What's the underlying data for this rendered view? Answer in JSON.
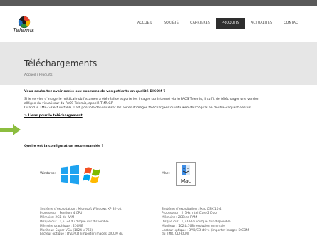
{
  "header": {
    "logo_text": "Telemis",
    "nav": [
      {
        "label": "ACCUEIL",
        "active": false
      },
      {
        "label": "SOCIÉTÉ",
        "active": false
      },
      {
        "label": "CARRIÈRES",
        "active": false
      },
      {
        "label": "PRODUITS",
        "active": true
      },
      {
        "label": "ACTUALITÉS",
        "active": false
      },
      {
        "label": "CONTAC",
        "active": false
      }
    ]
  },
  "page": {
    "title": "Téléchargements",
    "breadcrumb": "Accueil / Produits"
  },
  "content": {
    "question1": "Vous souhaitez avoir accès aux examens de vos patients en qualité DICOM ?",
    "para_lines": [
      "Si le service d'imagerie médicale où l'examen a été réalisé exporte les images sur Internet via le PACS Telemis, il suffit de télécharger une version",
      "allégée du visualiseur du PACS Telemis, appelé TMR-GP.",
      "Quand le TMR-GP est installé, il est possible de visualiser les series d'images téléchargées du site web de l'hôpital en double-cliquant dessus."
    ],
    "download_link": "> Liens pour le téléchargement",
    "question2": "Quelle est la configuration recommandée ?"
  },
  "windows": {
    "label": "Windows:",
    "specs": [
      "Système d'exploitation : Microsoft Windows XP 32-bit",
      "Processeur : Pentium 4 CPU",
      "Mémoire: 2GB de RAM",
      "Disque dur : 1,5 GB du disque dur disponible",
      "Mémoire graphique : 256MB",
      "Moniteur: Super VGA (1024 x 768)",
      "Lecteur optique : DVD/CD (importer images DICOM du"
    ]
  },
  "mac": {
    "label": "Mac:",
    "box_text": "Mac",
    "specs": [
      "Système d'exploitation : Mac OSX 10.4",
      "Processeur : 2 GHz Intel Core 2 Duo",
      "Mémoire : 2GB de RAM",
      "Disque dur : 1,5 GB du disque dur disponible",
      "Moniteur : 1024x768 résolution minimale",
      "Lecteur optique : DVD/CD drive (importer images DICOM",
      "du TMR, CD-ROM)"
    ]
  },
  "colors": {
    "topbar": "#5a5a5a",
    "band": "#e6e6e6",
    "nav_active": "#2e2e2e",
    "arrow": "#8cbd3f"
  }
}
